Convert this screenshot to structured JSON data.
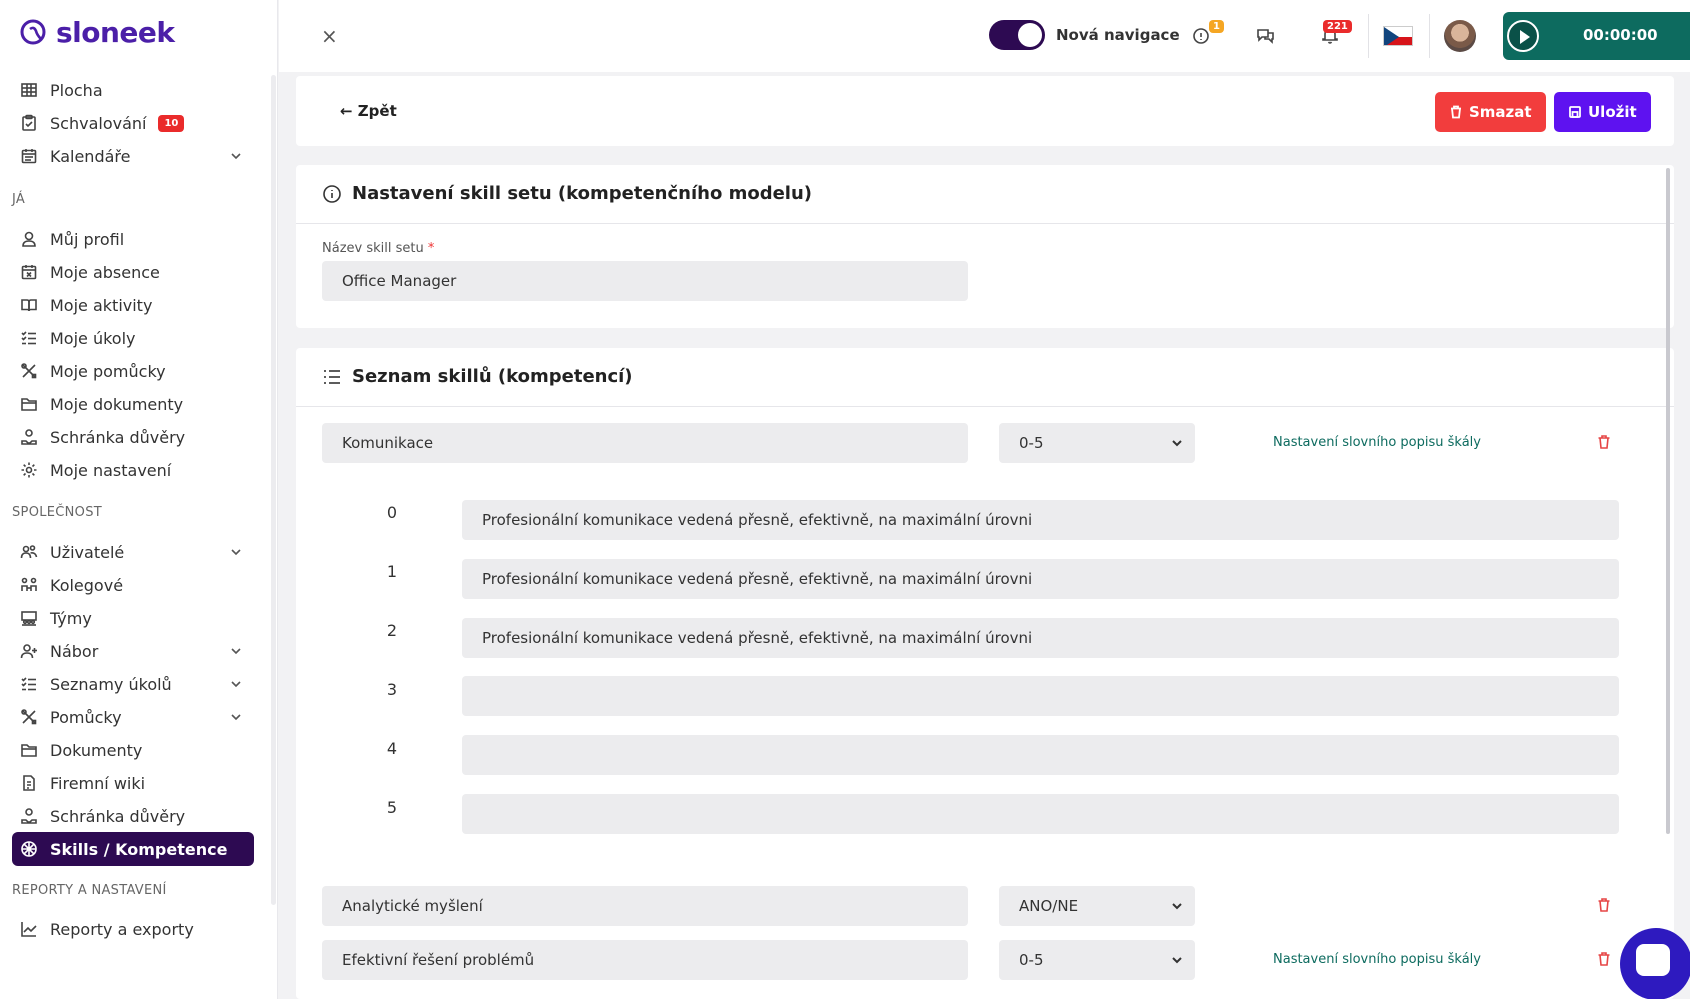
{
  "app": {
    "logo_text": "sloneek"
  },
  "sidebar": {
    "main_items": [
      {
        "label": "Plocha",
        "icon": "grid-icon"
      },
      {
        "label": "Schvalování",
        "icon": "clipboard-check-icon",
        "badge": "10"
      },
      {
        "label": "Kalendáře",
        "icon": "calendar-icon",
        "chevron": true
      }
    ],
    "section_me": "JÁ",
    "me_items": [
      {
        "label": "Můj profil",
        "icon": "user-icon"
      },
      {
        "label": "Moje absence",
        "icon": "calendar-x-icon"
      },
      {
        "label": "Moje aktivity",
        "icon": "book-open-icon"
      },
      {
        "label": "Moje úkoly",
        "icon": "task-list-icon"
      },
      {
        "label": "Moje pomůcky",
        "icon": "tools-icon"
      },
      {
        "label": "Moje dokumenty",
        "icon": "folder-icon"
      },
      {
        "label": "Schránka důvěry",
        "icon": "trust-box-icon"
      },
      {
        "label": "Moje nastavení",
        "icon": "gear-icon"
      }
    ],
    "section_company": "SPOLEČNOST",
    "company_items": [
      {
        "label": "Uživatelé",
        "icon": "users-icon",
        "chevron": true
      },
      {
        "label": "Kolegové",
        "icon": "colleagues-icon"
      },
      {
        "label": "Týmy",
        "icon": "teams-icon"
      },
      {
        "label": "Nábor",
        "icon": "user-plus-icon",
        "chevron": true
      },
      {
        "label": "Seznamy úkolů",
        "icon": "task-list-icon",
        "chevron": true
      },
      {
        "label": "Pomůcky",
        "icon": "tools-icon",
        "chevron": true
      },
      {
        "label": "Dokumenty",
        "icon": "folder-icon"
      },
      {
        "label": "Firemní wiki",
        "icon": "wiki-icon"
      },
      {
        "label": "Schránka důvěry",
        "icon": "trust-box-icon"
      },
      {
        "label": "Skills / Kompetence",
        "icon": "skills-icon",
        "active": true
      }
    ],
    "section_reports": "REPORTY A NASTAVENÍ",
    "reports_items": [
      {
        "label": "Reporty a exporty",
        "icon": "chart-line-icon"
      }
    ]
  },
  "topbar": {
    "close": "×",
    "toggle_label": "Nová navigace",
    "alerts_badge": "1",
    "notifications_badge": "221",
    "timer": "00:00:00",
    "accent": "#2d0a52",
    "timer_color": "#0d6b5f"
  },
  "header": {
    "back_label": "Zpět",
    "delete_label": "Smazat",
    "save_label": "Uložit",
    "delete_color": "#f23d3d",
    "save_color": "#5e12f0"
  },
  "settings": {
    "title": "Nastavení skill setu (kompetenčního modelu)",
    "name_label": "Název skill setu",
    "required_mark": "*",
    "name_value": "Office Manager"
  },
  "skills": {
    "title": "Seznam skillů (kompetencí)",
    "scale_link": "Nastavení slovního popisu škály",
    "items": [
      {
        "name": "Komunikace",
        "scale": "0-5",
        "has_link": true,
        "levels": [
          {
            "num": "0",
            "text": "Profesionální komunikace vedená přesně, efektivně, na maximální úrovni"
          },
          {
            "num": "1",
            "text": "Profesionální komunikace vedená přesně, efektivně, na maximální úrovni"
          },
          {
            "num": "2",
            "text": "Profesionální komunikace vedená přesně, efektivně, na maximální úrovni"
          },
          {
            "num": "3",
            "text": ""
          },
          {
            "num": "4",
            "text": ""
          },
          {
            "num": "5",
            "text": ""
          }
        ]
      },
      {
        "name": "Analytické myšlení",
        "scale": "ANO/NE",
        "has_link": false
      },
      {
        "name": "Efektivní řešení problémů",
        "scale": "0-5",
        "has_link": true
      }
    ]
  }
}
